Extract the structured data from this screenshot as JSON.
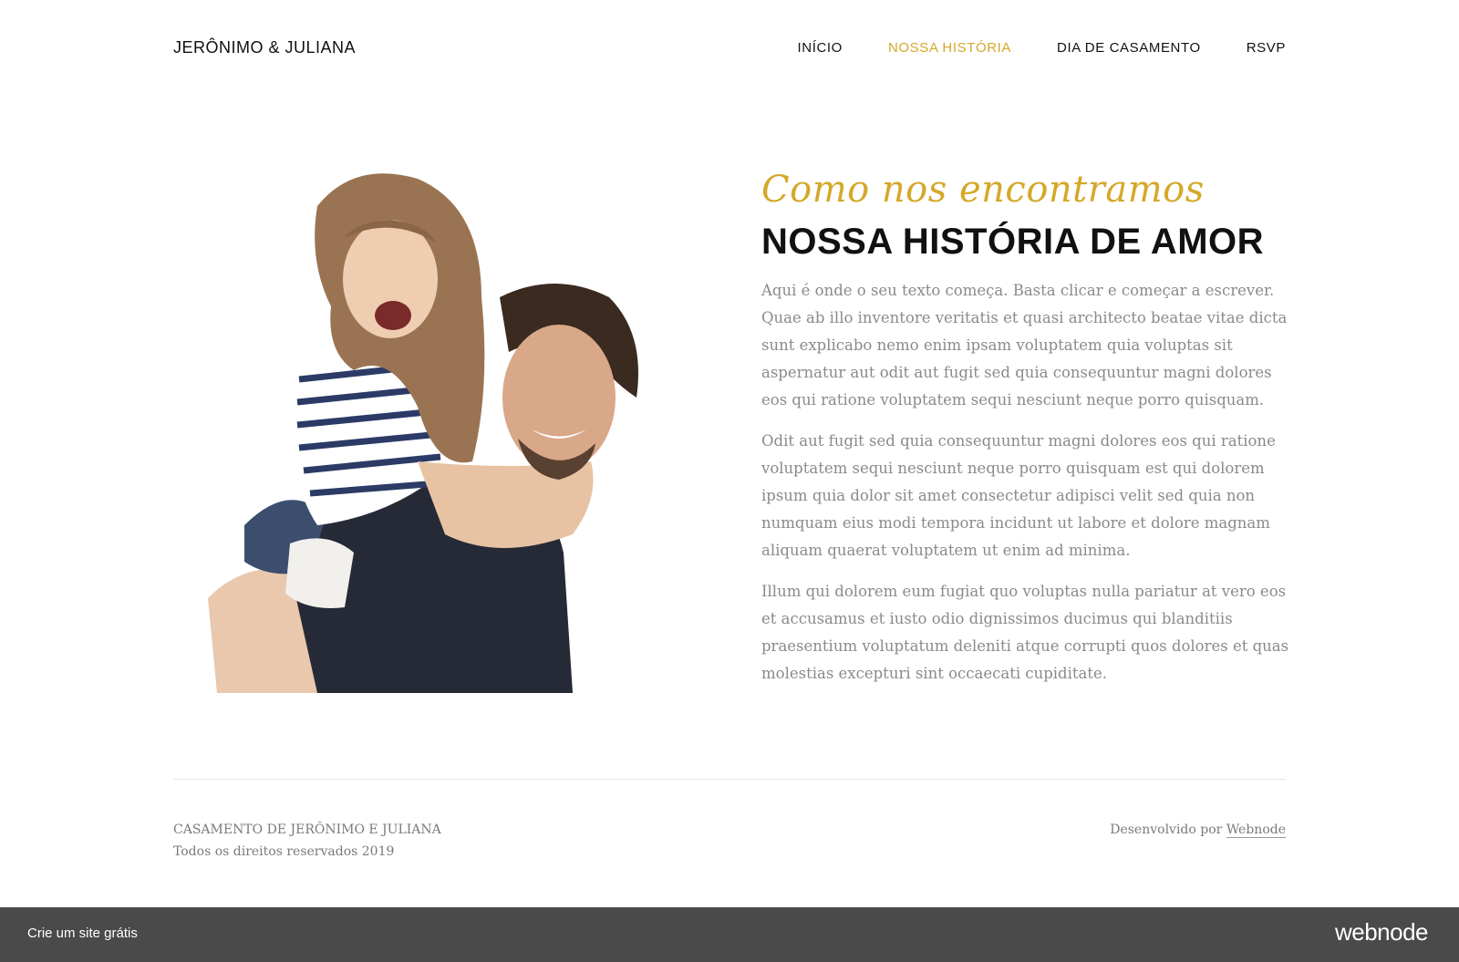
{
  "header": {
    "brand": "JERÔNIMO & JULIANA",
    "nav": [
      {
        "label": "INÍCIO",
        "active": false
      },
      {
        "label": "NOSSA HISTÓRIA",
        "active": true
      },
      {
        "label": "DIA DE CASAMENTO",
        "active": false
      },
      {
        "label": "RSVP",
        "active": false
      }
    ],
    "accent_color": "#d4a829"
  },
  "hero": {
    "subtitle": "Como nos encontramos",
    "title": "NOSSA HISTÓRIA DE AMOR",
    "paragraphs": [
      "Aqui é onde o seu texto começa. Basta clicar e começar a escrever. Quae ab illo inventore veritatis et quasi architecto beatae vitae dicta sunt explicabo nemo enim ipsam voluptatem quia voluptas sit aspernatur aut odit aut fugit sed quia consequuntur magni dolores eos qui ratione voluptatem sequi nesciunt neque porro quisquam.",
      "Odit aut fugit sed quia consequuntur magni dolores eos qui ratione voluptatem sequi nesciunt neque porro quisquam est qui dolorem ipsum quia dolor sit amet consectetur adipisci velit sed quia non numquam eius modi tempora incidunt ut labore et dolore magnam aliquam quaerat voluptatem ut enim ad minima.",
      "Illum qui dolorem eum fugiat quo voluptas nulla pariatur at vero eos et accusamus et iusto odio dignissimos ducimus qui blanditiis praesentium voluptatum deleniti atque corrupti quos dolores et quas molestias excepturi sint occaecati cupiditate."
    ]
  },
  "footer": {
    "line1": "CASAMENTO DE JERÔNIMO E JULIANA",
    "line2": "Todos os direitos reservados 2019",
    "powered_prefix": "Desenvolvido por",
    "powered_link": "Webnode"
  },
  "bottom_bar": {
    "link": "Crie um site grátis",
    "logo": "webnode",
    "background": "#4a4a4a"
  }
}
